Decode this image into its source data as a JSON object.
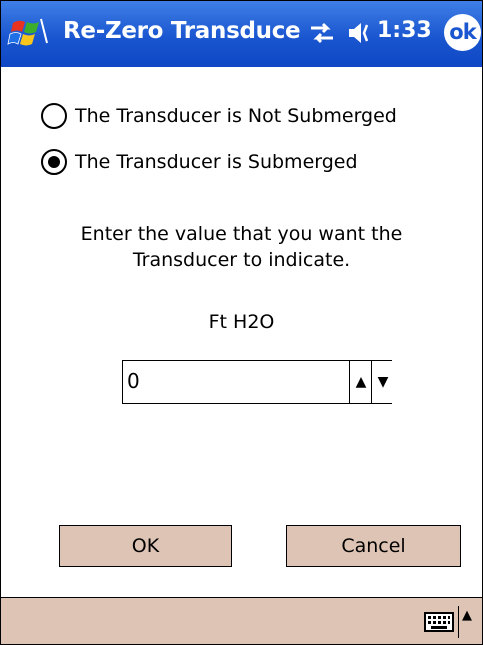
{
  "titlebar": {
    "title": "Re-Zero Transduce",
    "time": "1:33",
    "ok_label": "ok",
    "icons": [
      "windows-start-icon",
      "connectivity-icon",
      "speaker-icon"
    ]
  },
  "options": {
    "not_submerged_label": "The Transducer is Not Submerged",
    "submerged_label": "The Transducer is Submerged",
    "selected": "submerged"
  },
  "prompt": {
    "line1": "Enter the value that you want the",
    "line2": "Transducer to indicate."
  },
  "unit_label": "Ft H2O",
  "spinner": {
    "value": "0",
    "up_glyph": "▲",
    "down_glyph": "▼"
  },
  "buttons": {
    "ok_label": "OK",
    "cancel_label": "Cancel"
  },
  "menubar": {
    "sip_arrow": "▲",
    "icons": [
      "keyboard-icon"
    ]
  },
  "colors": {
    "titlebar": "#1a56d0",
    "button_face": "#dec4b5",
    "menubar": "#dec4b5"
  }
}
